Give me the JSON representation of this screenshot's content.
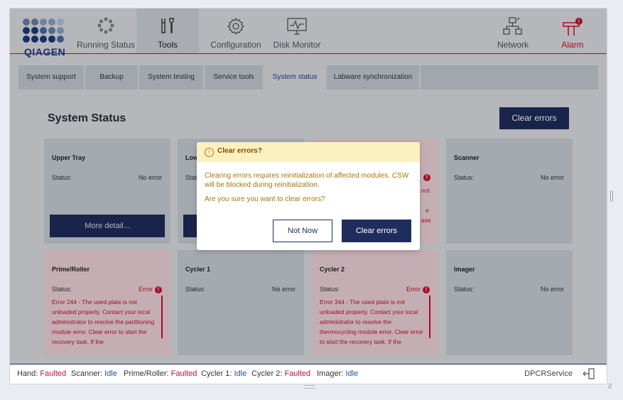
{
  "brand": {
    "logo_text": "QIAGEN",
    "dot_colors": [
      "#6b7fa6",
      "#6b7fa6",
      "#8da0c4",
      "#8da0c4",
      "#b7c4dd",
      "#1b3a7a",
      "#1b3a7a",
      "#4d68a6",
      "#6b7fa6",
      "#8da0c4",
      "#1b3a7a",
      "#1b3a7a",
      "#1b3a7a",
      "#1b3a7a",
      "#4d68a6"
    ]
  },
  "nav": {
    "items": [
      {
        "label": "Running Status",
        "icon": "dots-ring-icon"
      },
      {
        "label": "Tools",
        "icon": "tools-icon",
        "active": true
      },
      {
        "label": "Configuration",
        "icon": "gear-icon"
      },
      {
        "label": "Disk Monitor",
        "icon": "monitor-chart-icon"
      }
    ],
    "right": [
      {
        "label": "Network",
        "icon": "network-icon"
      },
      {
        "label": "Alarm",
        "icon": "alarm-icon"
      }
    ]
  },
  "tabs": [
    {
      "label": "System support"
    },
    {
      "label": "Backup"
    },
    {
      "label": "System testing"
    },
    {
      "label": "Service tools"
    },
    {
      "label": "System status",
      "active": true
    },
    {
      "label": "Labware synchronization"
    }
  ],
  "page": {
    "title": "System Status",
    "clear_errors_button": "Clear errors"
  },
  "cards": {
    "upper_tray": {
      "title": "Upper Tray",
      "status_label": "Status:",
      "status_value": "No error",
      "more_button": "More detail..."
    },
    "lower_tray": {
      "title": "Low",
      "status_label": "Stat"
    },
    "hidden_error": {
      "fragments": [
        "not",
        "e",
        "ase"
      ]
    },
    "scanner": {
      "title": "Scanner",
      "status_label": "Status:",
      "status_value": "No error"
    },
    "prime_roller": {
      "title": "Prime/Roller",
      "status_label": "Status:",
      "status_value": "Error",
      "message": "Error 244 - The used plate is not unloaded properly. Contact your local administrator to resolve the partitioning module error. Clear error to start the recovery task. If the"
    },
    "cycler1": {
      "title": "Cycler 1",
      "status_label": "Status:",
      "status_value": "No error"
    },
    "cycler2": {
      "title": "Cycler 2",
      "status_label": "Status:",
      "status_value": "Error",
      "message": "Error 344 - The used plate is not unloaded properly. Contact your local administrator to resolve the thermocycling module error. Clear error to start the recovery task. If the"
    },
    "imager": {
      "title": "Imager",
      "status_label": "Status:",
      "status_value": "No error"
    }
  },
  "modal": {
    "title": "Clear errors?",
    "message": "Clearing errors requires reinitialization of affected modules. CSW will be blocked during reinitialization.",
    "question": "Are you sure you want to clear errors?",
    "cancel_label": "Not Now",
    "confirm_label": "Clear errors"
  },
  "statusbar": {
    "hand_key": "Hand:",
    "hand_val": "Faulted",
    "scanner_key": "Scanner:",
    "scanner_val": "Idle",
    "prime_key": "Prime/Roller:",
    "prime_val": "Faulted",
    "cycler1_key": "Cycler 1:",
    "cycler1_val": "Idle",
    "cycler2_key": "Cycler 2:",
    "cycler2_val": "Faulted",
    "imager_key": "Imager:",
    "imager_val": "Idle",
    "user": "DPCRService"
  },
  "colors": {
    "primary": "#1f2d5c",
    "error": "#c8102e",
    "warning_bg": "#fcf0c0",
    "warning_text": "#a8750a",
    "idle": "#1f4fa3"
  }
}
